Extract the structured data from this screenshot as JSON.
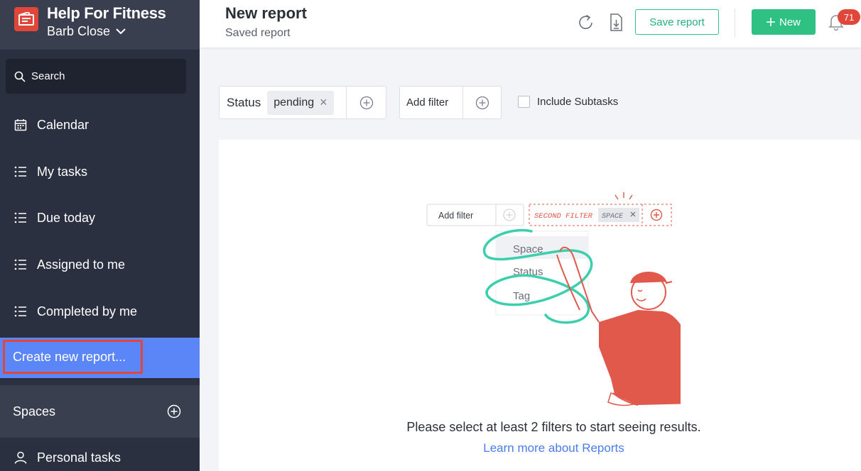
{
  "workspace": {
    "name": "Help For Fitness",
    "user": "Barb Close"
  },
  "sidebar": {
    "search_label": "Search",
    "items": [
      {
        "label": "Calendar",
        "icon": "calendar-icon"
      },
      {
        "label": "My tasks",
        "icon": "list-icon"
      },
      {
        "label": "Due today",
        "icon": "list-icon"
      },
      {
        "label": "Assigned to me",
        "icon": "list-icon"
      },
      {
        "label": "Completed by me",
        "icon": "list-icon"
      }
    ],
    "create_report": "Create new report...",
    "spaces_label": "Spaces",
    "personal_tasks": "Personal tasks"
  },
  "header": {
    "title": "New report",
    "subtitle": "Saved report",
    "save_label": "Save report",
    "new_label": "New",
    "notification_count": "71"
  },
  "filters": {
    "status_label": "Status",
    "status_value": "pending",
    "add_filter_label": "Add filter",
    "include_subtasks_label": "Include Subtasks"
  },
  "illustration": {
    "add_filter": "Add filter",
    "second_filter": "SECOND FILTER",
    "space_chip": "SPACE",
    "options": [
      "Space",
      "Status",
      "Tag"
    ]
  },
  "empty_state": {
    "message": "Please select at least 2 filters to start seeing results.",
    "link": "Learn more about Reports"
  },
  "colors": {
    "sidebar_bg": "#2b3040",
    "accent_blue": "#5b86f7",
    "brand_red": "#e0473a",
    "green": "#2fc083",
    "link_blue": "#4a7cf0"
  }
}
